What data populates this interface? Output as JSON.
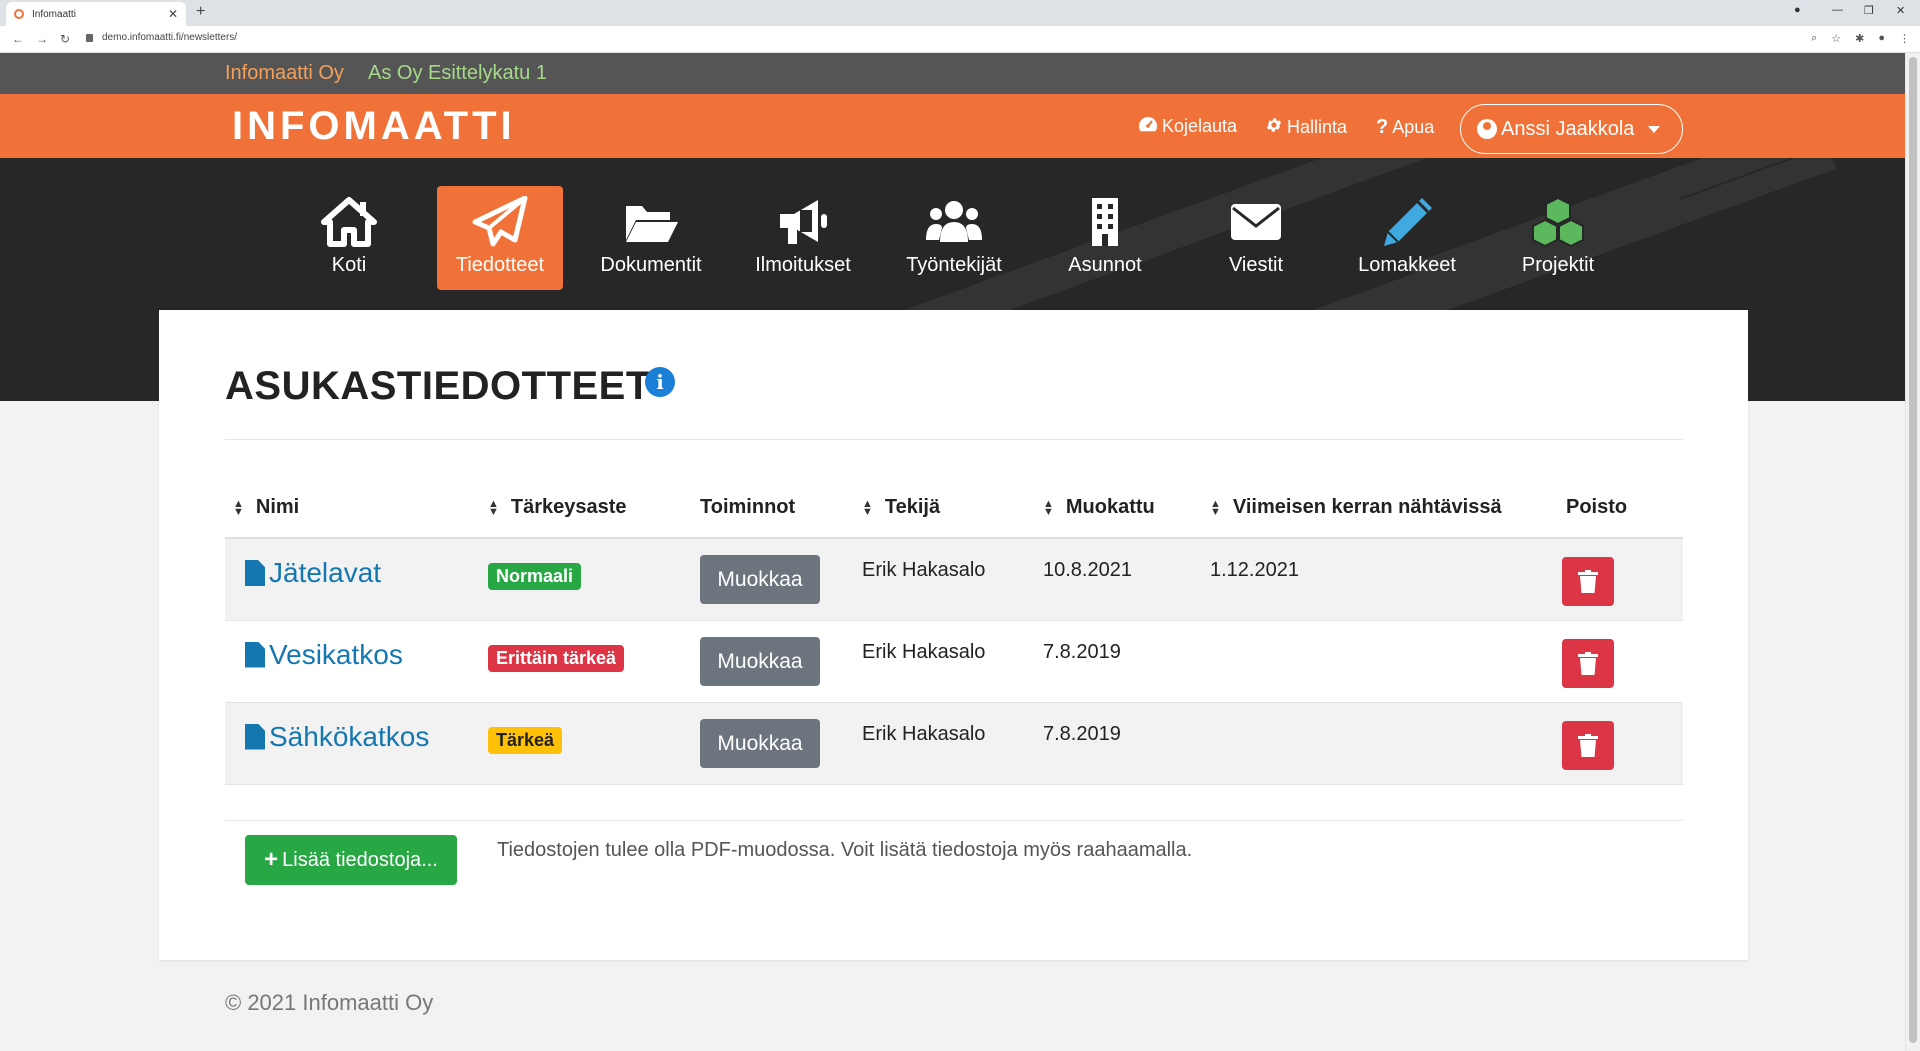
{
  "browser": {
    "tab_title": "Infomaatti",
    "url": "demo.infomaatti.fi/newsletters/"
  },
  "infostrip": {
    "company": "Infomaatti Oy",
    "property": "As Oy Esittelykatu 1"
  },
  "header": {
    "logo": "INFOMAATTI",
    "links": [
      {
        "label": "Kojelauta",
        "icon": "dashboard-icon"
      },
      {
        "label": "Hallinta",
        "icon": "gear-icon"
      },
      {
        "label": "Apua",
        "icon": "question-icon"
      }
    ],
    "user": "Anssi Jaakkola"
  },
  "mainnav": [
    {
      "label": "Koti",
      "icon": "home-icon"
    },
    {
      "label": "Tiedotteet",
      "icon": "paper-plane-icon",
      "active": true
    },
    {
      "label": "Dokumentit",
      "icon": "folder-icon"
    },
    {
      "label": "Ilmoitukset",
      "icon": "megaphone-icon"
    },
    {
      "label": "Työntekijät",
      "icon": "users-icon"
    },
    {
      "label": "Asunnot",
      "icon": "building-icon"
    },
    {
      "label": "Viestit",
      "icon": "envelope-icon"
    },
    {
      "label": "Lomakkeet",
      "icon": "pencil-icon"
    },
    {
      "label": "Projektit",
      "icon": "cubes-icon"
    }
  ],
  "page": {
    "title": "ASUKASTIEDOTTEET",
    "info_glyph": "i",
    "columns": [
      "Nimi",
      "Tärkeysaste",
      "Toiminnot",
      "Tekijä",
      "Muokattu",
      "Viimeisen kerran nähtävissä",
      "Poisto"
    ],
    "rows": [
      {
        "name": "Jätelavat",
        "priority": "Normaali",
        "priority_level": "normal",
        "action": "Muokkaa",
        "author": "Erik Hakasalo",
        "modified": "10.8.2021",
        "visible_until": "1.12.2021"
      },
      {
        "name": "Vesikatkos",
        "priority": "Erittäin tärkeä",
        "priority_level": "critical",
        "action": "Muokkaa",
        "author": "Erik Hakasalo",
        "modified": "7.8.2019",
        "visible_until": ""
      },
      {
        "name": "Sähkökatkos",
        "priority": "Tärkeä",
        "priority_level": "important",
        "action": "Muokkaa",
        "author": "Erik Hakasalo",
        "modified": "7.8.2019",
        "visible_until": ""
      }
    ],
    "add_button": "Lisää tiedostoja...",
    "help_text": "Tiedostojen tulee olla PDF-muodossa. Voit lisätä tiedostoja myös raahaamalla."
  },
  "footer": "© 2021 Infomaatti Oy",
  "colors": {
    "brand_orange": "#f07238",
    "info_strip": "#555555",
    "dark_band": "#272727",
    "link_blue": "#1577b0",
    "success": "#28a745",
    "danger": "#dc3545",
    "warning": "#ffc107",
    "secondary": "#6c757d"
  }
}
